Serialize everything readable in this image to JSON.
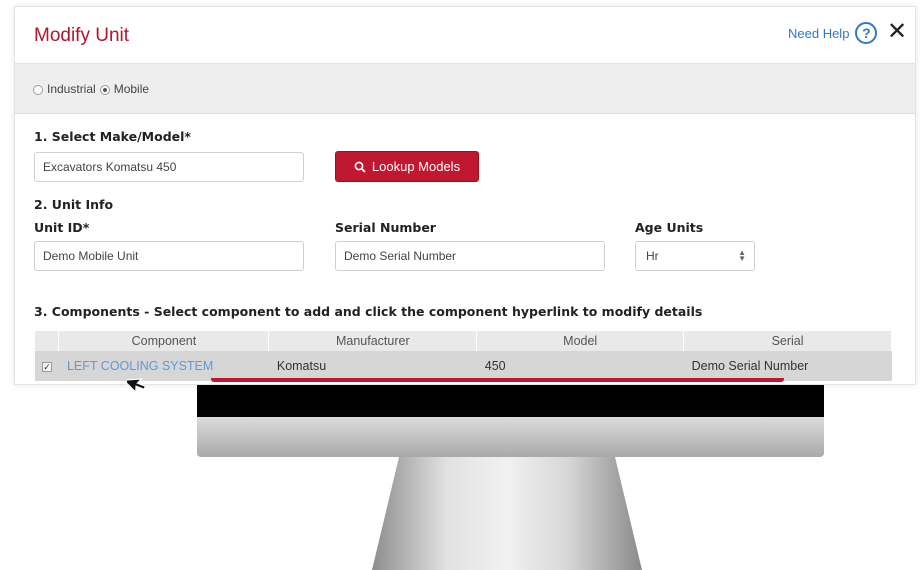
{
  "dialog": {
    "title": "Modify Unit",
    "help_label": "Need Help",
    "help_icon_glyph": "?",
    "close_glyph": "✕"
  },
  "unit_type": {
    "options": [
      {
        "label": "Industrial",
        "checked": false
      },
      {
        "label": "Mobile",
        "checked": true
      }
    ]
  },
  "make_model": {
    "section_title": "1. Select Make/Model*",
    "value": "Excavators Komatsu 450",
    "lookup_button_label": "Lookup Models"
  },
  "unit_info": {
    "section_title": "2. Unit Info",
    "unit_id_label": "Unit ID*",
    "unit_id_value": "Demo Mobile Unit",
    "serial_label": "Serial Number",
    "serial_value": "Demo Serial Number",
    "age_units_label": "Age Units",
    "age_units_value": "Hr"
  },
  "components": {
    "section_title": "3. Components  - Select component to add and click the component hyperlink to modify details",
    "columns": [
      "Component",
      "Manufacturer",
      "Model",
      "Serial"
    ],
    "rows": [
      {
        "checked": true,
        "component": "LEFT COOLING SYSTEM",
        "manufacturer": "Komatsu",
        "model": "450",
        "serial": "Demo Serial Number"
      }
    ]
  },
  "colors": {
    "accent_red": "#c0182e",
    "title_red": "#b3152f",
    "link_blue": "#2f7ac7",
    "component_link": "#5b9bd5"
  },
  "icons": [
    "help-circle-icon",
    "close-icon",
    "search-icon",
    "sort-arrows-icon",
    "mouse-pointer-icon"
  ]
}
